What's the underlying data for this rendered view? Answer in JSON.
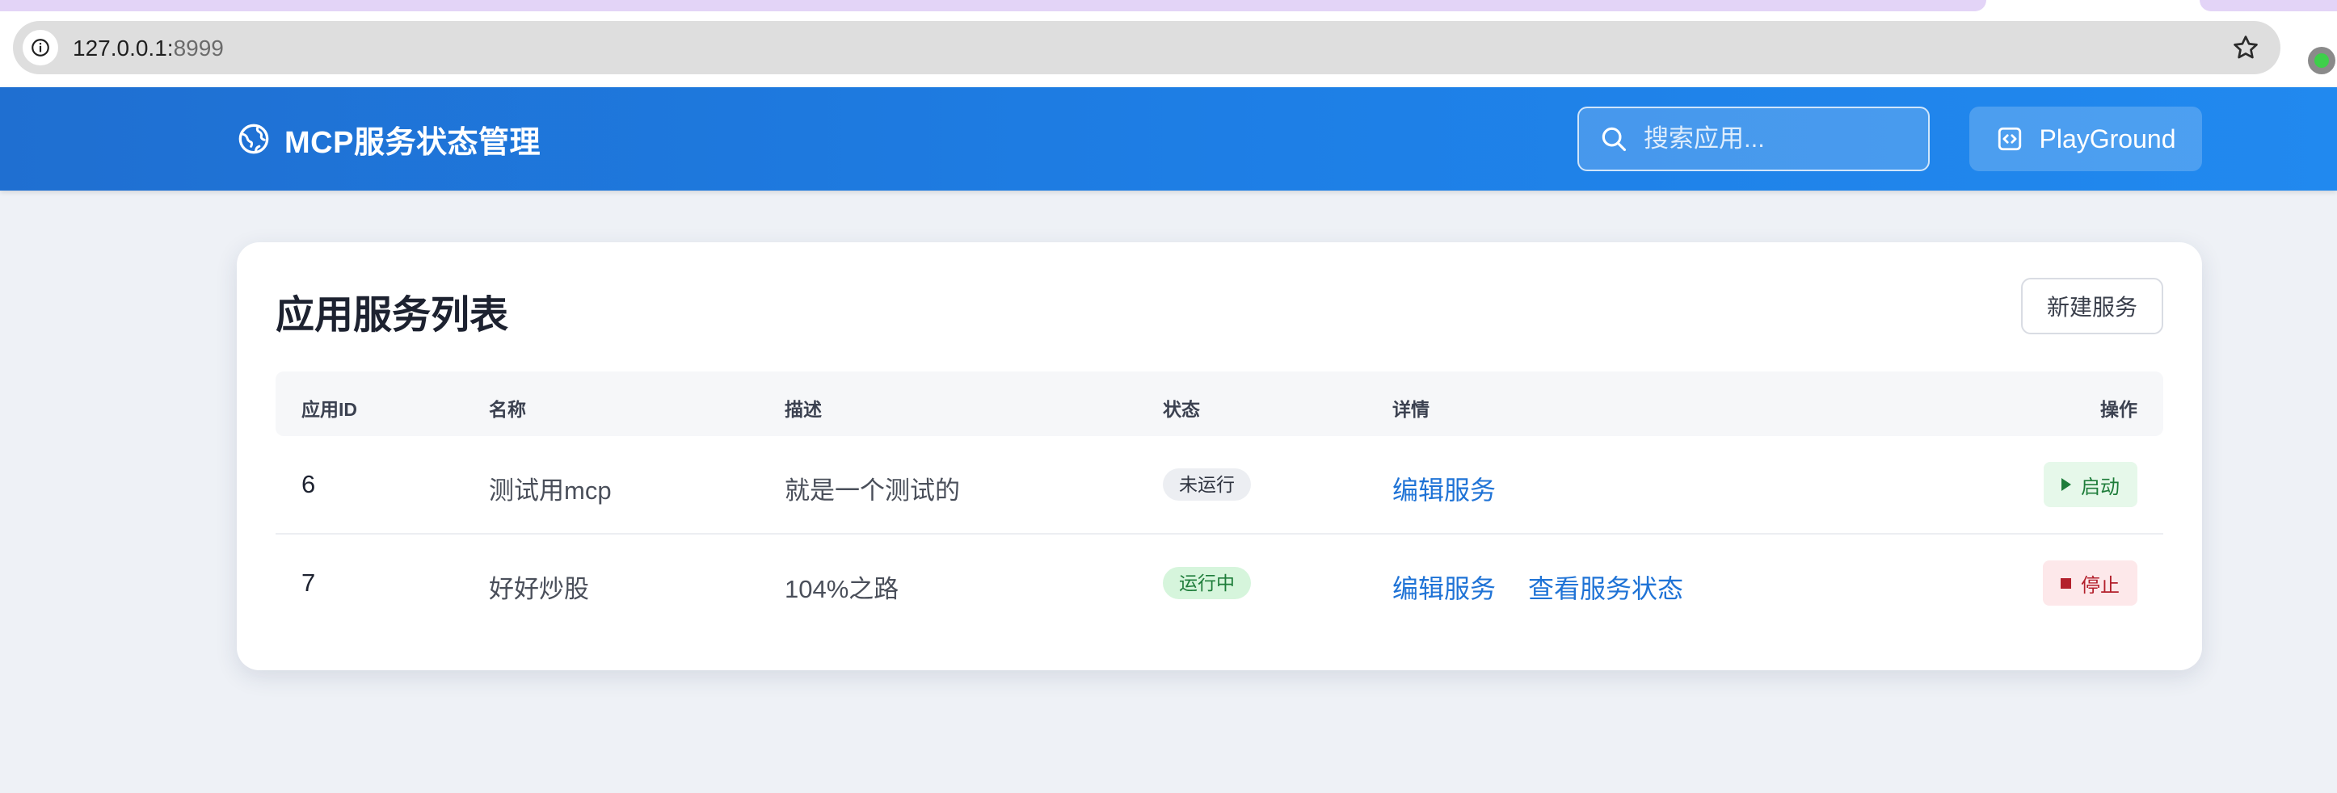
{
  "browser": {
    "url_host": "127.0.0.1:",
    "url_port": "8999"
  },
  "header": {
    "title": "MCP服务状态管理",
    "search_placeholder": "搜索应用...",
    "playground_label": "PlayGround"
  },
  "card": {
    "title": "应用服务列表",
    "new_service_label": "新建服务"
  },
  "table": {
    "columns": [
      "应用ID",
      "名称",
      "描述",
      "状态",
      "详情",
      "操作"
    ],
    "rows": [
      {
        "id": "6",
        "name": "测试用mcp",
        "description": "就是一个测试的",
        "status": "未运行",
        "links": [
          "编辑服务"
        ],
        "action": "启动"
      },
      {
        "id": "7",
        "name": "好好炒股",
        "description": "104%之路",
        "status": "运行中",
        "links": [
          "编辑服务",
          "查看服务状态"
        ],
        "action": "停止"
      }
    ]
  },
  "colors": {
    "header_blue": "#1e7fe6",
    "link_blue": "#1f73d6",
    "running_green": "#1e7d3a",
    "stop_red": "#b3202c"
  }
}
